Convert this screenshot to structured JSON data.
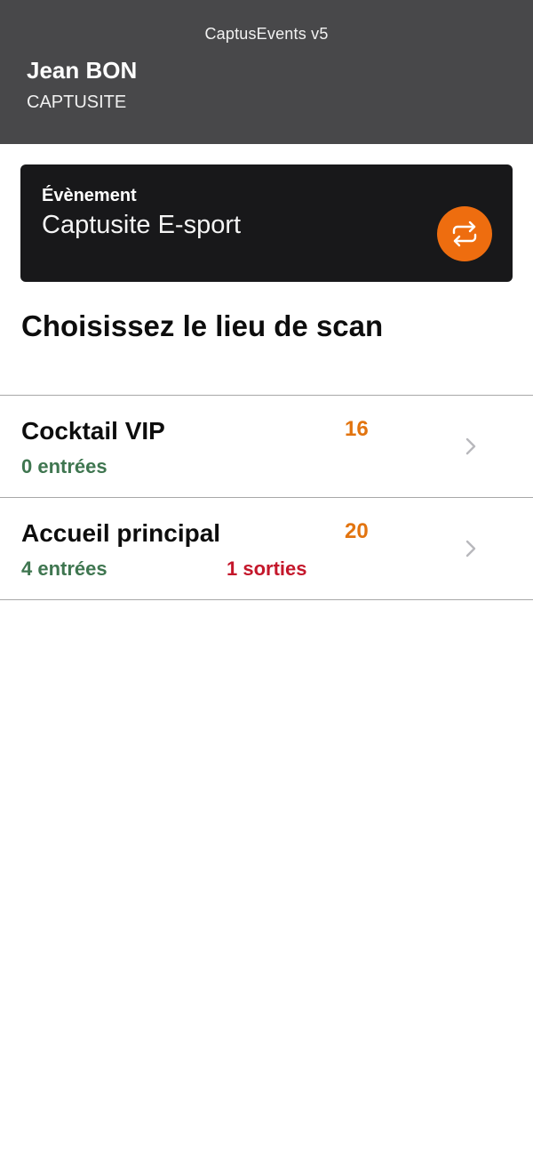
{
  "header": {
    "app_title": "CaptusEvents v5",
    "user_name": "Jean BON",
    "company": "CAPTUSITE"
  },
  "event": {
    "label": "Évènement",
    "name": "Captusite E-sport",
    "switch_icon": "swap-arrows-icon"
  },
  "heading": "Choisissez le lieu de scan",
  "locations": [
    {
      "name": "Cocktail VIP",
      "count": "16",
      "entries": "0 entrées",
      "exits": ""
    },
    {
      "name": "Accueil principal",
      "count": "20",
      "entries": "4 entrées",
      "exits": "1 sorties"
    }
  ],
  "colors": {
    "header_bg": "#48484a",
    "card_bg": "#18181a",
    "accent": "#ee6d0f",
    "count": "#e2740f",
    "entries": "#3f7650",
    "exits": "#c4172b"
  }
}
